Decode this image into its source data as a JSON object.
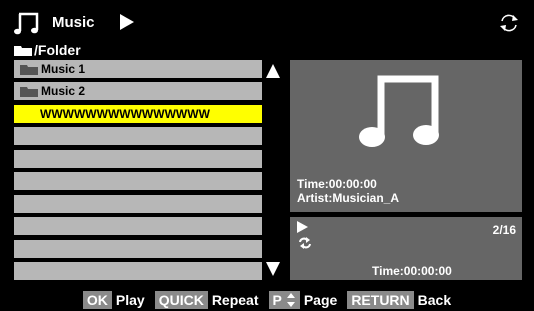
{
  "header": {
    "title": "Music"
  },
  "folder": {
    "path": "/Folder"
  },
  "list": {
    "items": [
      {
        "label": "Music 1",
        "type": "folder"
      },
      {
        "label": "Music 2",
        "type": "folder"
      },
      {
        "label": "WWWWWWWWWWWWWWW",
        "type": "file",
        "selected": true
      },
      {
        "label": ""
      },
      {
        "label": ""
      },
      {
        "label": ""
      },
      {
        "label": ""
      },
      {
        "label": ""
      },
      {
        "label": ""
      }
    ]
  },
  "info": {
    "time": "Time:00:00:00",
    "artist": "Artist:Musician_A"
  },
  "status": {
    "track": "2/16",
    "time": "Time:00:00:00"
  },
  "footer": {
    "ok_key": "OK",
    "ok_label": "Play",
    "quick_key": "QUICK",
    "quick_label": "Repeat",
    "p_key": "P",
    "p_label": "Page",
    "return_key": "RETURN",
    "return_label": "Back"
  },
  "colors": {
    "row": "#b7b7b7",
    "selected": "#ffff00",
    "panel": "#666666",
    "key_bg": "#8a8a8a"
  },
  "icons": [
    "music-note-icon",
    "play-icon",
    "refresh-icon",
    "folder-icon",
    "scroll-up-icon",
    "scroll-down-icon",
    "repeat-icon",
    "up-down-icon"
  ]
}
